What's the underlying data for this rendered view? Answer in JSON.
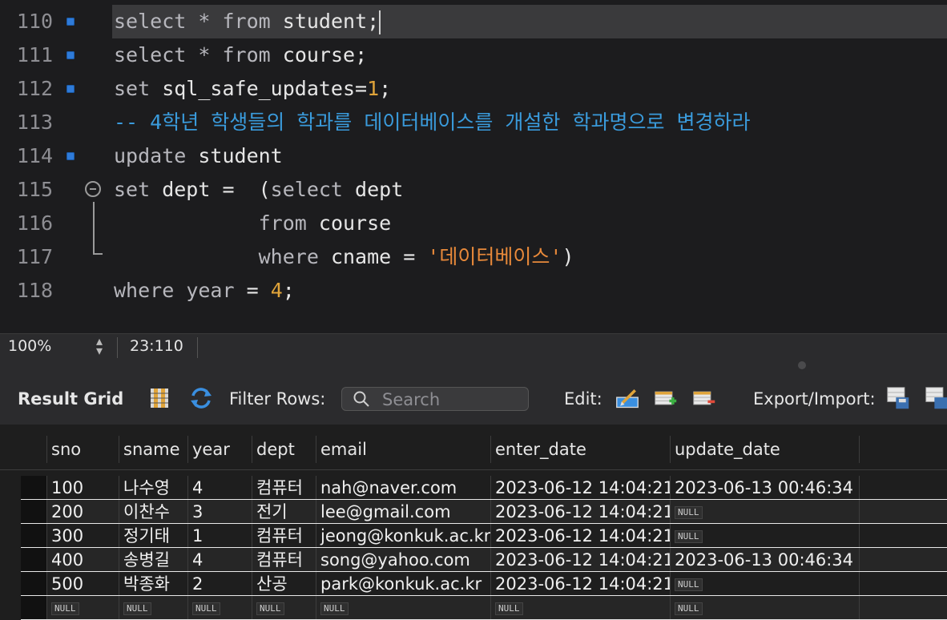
{
  "editor": {
    "lines": [
      {
        "num": "110",
        "bp": true,
        "current": true,
        "tokens": [
          [
            "kw",
            "select"
          ],
          [
            "id",
            " "
          ],
          [
            "kw",
            "*"
          ],
          [
            "id",
            " "
          ],
          [
            "kw",
            "from"
          ],
          [
            "id",
            " student;"
          ]
        ],
        "cursor": true
      },
      {
        "num": "111",
        "bp": true,
        "tokens": [
          [
            "kw",
            "select"
          ],
          [
            "id",
            " "
          ],
          [
            "kw",
            "*"
          ],
          [
            "id",
            " "
          ],
          [
            "kw",
            "from"
          ],
          [
            "id",
            " course;"
          ]
        ]
      },
      {
        "num": "112",
        "bp": true,
        "tokens": [
          [
            "kw",
            "set"
          ],
          [
            "id",
            " sql_safe_updates="
          ],
          [
            "num",
            "1"
          ],
          [
            "id",
            ";"
          ]
        ]
      },
      {
        "num": "113",
        "bp": false,
        "tokens": [
          [
            "cmt",
            "-- 4학년 학생들의 학과를 데이터베이스를 개설한 학과명으로 변경하라"
          ]
        ]
      },
      {
        "num": "114",
        "bp": true,
        "tokens": [
          [
            "kw",
            "update"
          ],
          [
            "id",
            " student"
          ]
        ]
      },
      {
        "num": "115",
        "bp": false,
        "fold": true,
        "tokens": [
          [
            "kw",
            "set"
          ],
          [
            "id",
            " dept =  ("
          ],
          [
            "kw",
            "select"
          ],
          [
            "id",
            " dept"
          ]
        ]
      },
      {
        "num": "116",
        "bp": false,
        "tokens": [
          [
            "id",
            "            "
          ],
          [
            "kw",
            "from"
          ],
          [
            "id",
            " course"
          ]
        ]
      },
      {
        "num": "117",
        "bp": false,
        "tokens": [
          [
            "id",
            "            "
          ],
          [
            "kw",
            "where"
          ],
          [
            "id",
            " cname = "
          ],
          [
            "str",
            "'데이터베이스'"
          ],
          [
            "id",
            ")"
          ]
        ]
      },
      {
        "num": "118",
        "bp": false,
        "tokens": [
          [
            "kw",
            "where"
          ],
          [
            "id",
            " "
          ],
          [
            "kw",
            "year"
          ],
          [
            "id",
            " = "
          ],
          [
            "num",
            "4"
          ],
          [
            "id",
            ";"
          ]
        ]
      }
    ]
  },
  "status": {
    "zoom": "100%",
    "position": "23:110"
  },
  "toolbar": {
    "result_grid": "Result Grid",
    "filter_rows": "Filter Rows:",
    "search_placeholder": "Search",
    "edit": "Edit:",
    "export_import": "Export/Import:"
  },
  "grid": {
    "columns": [
      "sno",
      "sname",
      "year",
      "dept",
      "email",
      "enter_date",
      "update_date"
    ],
    "null_label": "NULL",
    "rows": [
      [
        "100",
        "나수영",
        "4",
        "컴퓨터",
        "nah@naver.com",
        "2023-06-12 14:04:21",
        "2023-06-13 00:46:34"
      ],
      [
        "200",
        "이찬수",
        "3",
        "전기",
        "lee@gmail.com",
        "2023-06-12 14:04:21",
        null
      ],
      [
        "300",
        "정기태",
        "1",
        "컴퓨터",
        "jeong@konkuk.ac.kr",
        "2023-06-12 14:04:21",
        null
      ],
      [
        "400",
        "송병길",
        "4",
        "컴퓨터",
        "song@yahoo.com",
        "2023-06-12 14:04:21",
        "2023-06-13 00:46:34"
      ],
      [
        "500",
        "박종화",
        "2",
        "산공",
        "park@konkuk.ac.kr",
        "2023-06-12 14:04:21",
        null
      ],
      [
        null,
        null,
        null,
        null,
        null,
        null,
        null
      ]
    ]
  }
}
